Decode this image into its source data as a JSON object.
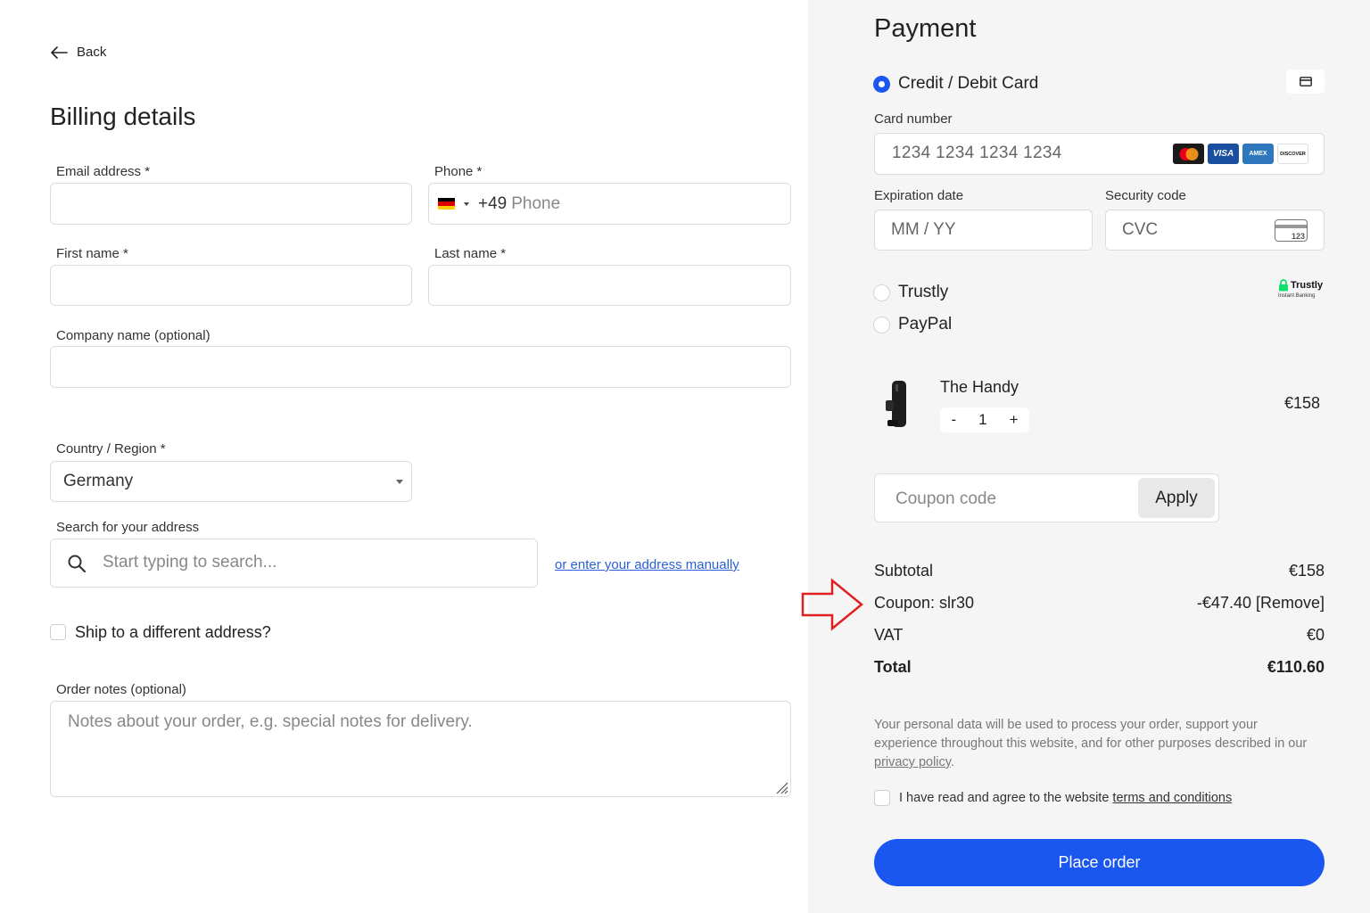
{
  "back": {
    "label": "Back"
  },
  "billing": {
    "title": "Billing details",
    "email_label": "Email address *",
    "phone_label": "Phone *",
    "phone_code": "+49",
    "phone_placeholder": "Phone",
    "first_name_label": "First name *",
    "last_name_label": "Last name *",
    "company_label": "Company name (optional)",
    "country_label": "Country / Region *",
    "country_value": "Germany",
    "search_label": "Search for your address",
    "search_placeholder": "Start typing to search...",
    "manual_link": "or enter your address manually",
    "ship_label": "Ship to a different address?",
    "notes_label": "Order notes (optional)",
    "notes_placeholder": "Notes about your order, e.g. special notes for delivery."
  },
  "payment": {
    "title": "Payment",
    "card_option": "Credit / Debit Card",
    "card_number_label": "Card number",
    "card_number_placeholder": "1234 1234 1234 1234",
    "card_brands": [
      "VISA",
      "AMEX",
      "DISCOVER"
    ],
    "expiry_label": "Expiration date",
    "expiry_placeholder": "MM / YY",
    "cvc_label": "Security code",
    "cvc_placeholder": "CVC",
    "cvc_icon_text": "123",
    "trustly_option": "Trustly",
    "trustly_logo": "Trustly",
    "trustly_sub": "Instant Banking",
    "paypal_option": "PayPal"
  },
  "product": {
    "name": "The Handy",
    "qty_minus": "-",
    "qty": "1",
    "qty_plus": "+",
    "price": "€158"
  },
  "coupon": {
    "placeholder": "Coupon code",
    "apply_label": "Apply"
  },
  "summary": {
    "subtotal_label": "Subtotal",
    "subtotal_value": "€158",
    "coupon_label": "Coupon: slr30",
    "coupon_value": "-€47.40 [Remove]",
    "vat_label": "VAT",
    "vat_value": "€0",
    "total_label": "Total",
    "total_value": "€110.60"
  },
  "privacy": {
    "text": "Your personal data will be used to process your order, support your experience throughout this website, and for other purposes described in our ",
    "link": "privacy policy",
    "end": "."
  },
  "terms": {
    "text": "I have read and agree to the website ",
    "link": "terms and conditions"
  },
  "place_order": "Place order",
  "colors": {
    "accent": "#1a56f0",
    "right_panel_bg": "#f5f5f5",
    "annotation_arrow": "#e02020"
  }
}
